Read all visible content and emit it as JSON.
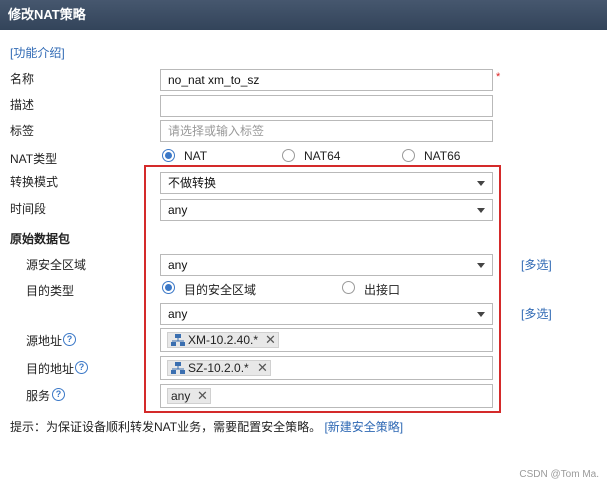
{
  "window": {
    "title": "修改NAT策略"
  },
  "intro_link": "[功能介绍]",
  "fields": {
    "name": {
      "label": "名称",
      "value": "no_nat xm_to_sz",
      "required_mark": "*"
    },
    "description": {
      "label": "描述",
      "value": ""
    },
    "tag": {
      "label": "标签",
      "placeholder": "请选择或输入标签"
    },
    "nat_type": {
      "label": "NAT类型",
      "options": [
        "NAT",
        "NAT64",
        "NAT66"
      ],
      "selected": "NAT"
    },
    "convert_mode": {
      "label": "转换模式",
      "value": "不做转换"
    },
    "time_range": {
      "label": "时间段",
      "value": "any"
    }
  },
  "original_packet": {
    "heading": "原始数据包",
    "src_zone": {
      "label": "源安全区域",
      "value": "any",
      "multi_link": "[多选]"
    },
    "dst_type": {
      "label": "目的类型",
      "options": [
        "目的安全区域",
        "出接口"
      ],
      "selected": "目的安全区域"
    },
    "dst_zone": {
      "value": "any",
      "multi_link": "[多选]"
    },
    "src_addr": {
      "label": "源地址",
      "tag": "XM-10.2.40.*"
    },
    "dst_addr": {
      "label": "目的地址",
      "tag": "SZ-10.2.0.*"
    },
    "service": {
      "label": "服务",
      "tag": "any"
    }
  },
  "hint": {
    "text": "提示：为保证设备顺利转发NAT业务，需要配置安全策略。",
    "link": "[新建安全策略]"
  },
  "watermark": "CSDN @Tom Ma.",
  "colors": {
    "titlebar": "#3c4d63",
    "link": "#2f69b4",
    "highlight_box": "#d42a2a",
    "radio_checked": "#3b78c7"
  }
}
